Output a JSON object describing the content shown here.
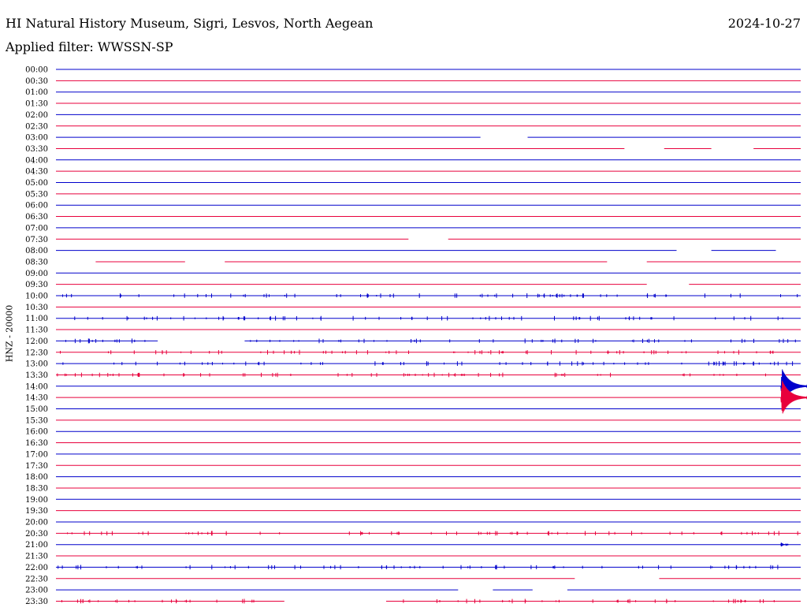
{
  "header": {
    "station": "HI Natural History Museum, Sigri, Lesvos, North Aegean",
    "filter": "Applied filter: WWSSN-SP",
    "date": "2024-10-27",
    "channel_label": "HNZ - 20000"
  },
  "colors": {
    "even_trace": "#0000cc",
    "odd_trace": "#e8003c"
  },
  "chart_data": {
    "type": "line",
    "title": "HI Natural History Museum, Sigri, Lesvos, North Aegean",
    "subtitle": "Applied filter: WWSSN-SP",
    "ylabel": "HNZ - 20000",
    "xlim_minutes": [
      0,
      30
    ],
    "trace_row_labels": [
      "00:00",
      "00:30",
      "01:00",
      "01:30",
      "02:00",
      "02:30",
      "03:00",
      "03:30",
      "04:00",
      "04:30",
      "05:00",
      "05:30",
      "06:00",
      "06:30",
      "07:00",
      "07:30",
      "08:00",
      "08:30",
      "09:00",
      "09:30",
      "10:00",
      "10:30",
      "11:00",
      "11:30",
      "12:00",
      "12:30",
      "13:00",
      "13:30",
      "14:00",
      "14:30",
      "15:00",
      "15:30",
      "16:00",
      "16:30",
      "17:00",
      "17:30",
      "18:00",
      "18:30",
      "19:00",
      "19:30",
      "20:00",
      "20:30",
      "21:00",
      "21:30",
      "22:00",
      "22:30",
      "23:00",
      "23:30"
    ],
    "data_gaps_minutes": {
      "03:00": [
        [
          17.1,
          19.0
        ]
      ],
      "03:30": [
        [
          22.9,
          24.5
        ],
        [
          26.4,
          28.1
        ]
      ],
      "07:30": [
        [
          14.2,
          15.8
        ]
      ],
      "08:00": [
        [
          25.0,
          26.4
        ],
        [
          29.0,
          30.0
        ]
      ],
      "08:30": [
        [
          0.0,
          1.6
        ],
        [
          5.2,
          6.8
        ],
        [
          22.2,
          23.8
        ]
      ],
      "09:30": [
        [
          23.8,
          25.5
        ]
      ],
      "12:00": [
        [
          4.1,
          7.6
        ]
      ],
      "22:30": [
        [
          20.9,
          24.3
        ]
      ],
      "23:00": [
        [
          16.2,
          17.6
        ],
        [
          19.2,
          20.6
        ]
      ],
      "23:30": [
        [
          9.2,
          13.3
        ]
      ]
    },
    "events": [
      {
        "row": "14:00",
        "minute": 29.2,
        "amplitude": "large",
        "duration_minutes": 1.2
      },
      {
        "row": "14:30",
        "minute": 29.2,
        "amplitude": "large",
        "duration_minutes": 1.2
      },
      {
        "row": "21:00",
        "minute": 29.2,
        "amplitude": "small",
        "duration_minutes": 0.3
      }
    ],
    "noise_rows": [
      "10:00",
      "11:00",
      "12:00",
      "12:30",
      "13:00",
      "13:30",
      "20:30",
      "22:00",
      "23:30"
    ]
  }
}
